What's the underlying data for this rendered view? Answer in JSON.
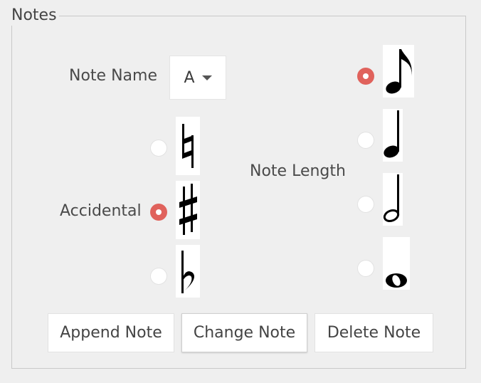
{
  "group": {
    "title": "Notes"
  },
  "note_name": {
    "label": "Note Name",
    "selected": "A"
  },
  "accidental": {
    "label": "Accidental",
    "options": [
      {
        "icon": "natural-icon",
        "selected": false
      },
      {
        "icon": "sharp-icon",
        "selected": true
      },
      {
        "icon": "flat-icon",
        "selected": false
      }
    ]
  },
  "note_length": {
    "label": "Note Length",
    "options": [
      {
        "icon": "eighth-note-icon",
        "selected": true
      },
      {
        "icon": "quarter-note-icon",
        "selected": false
      },
      {
        "icon": "half-note-icon",
        "selected": false
      },
      {
        "icon": "whole-note-icon",
        "selected": false
      }
    ]
  },
  "buttons": {
    "append": "Append Note",
    "change": "Change Note",
    "delete": "Delete Note"
  },
  "colors": {
    "accent": "#e0625c",
    "background": "#efefef"
  }
}
